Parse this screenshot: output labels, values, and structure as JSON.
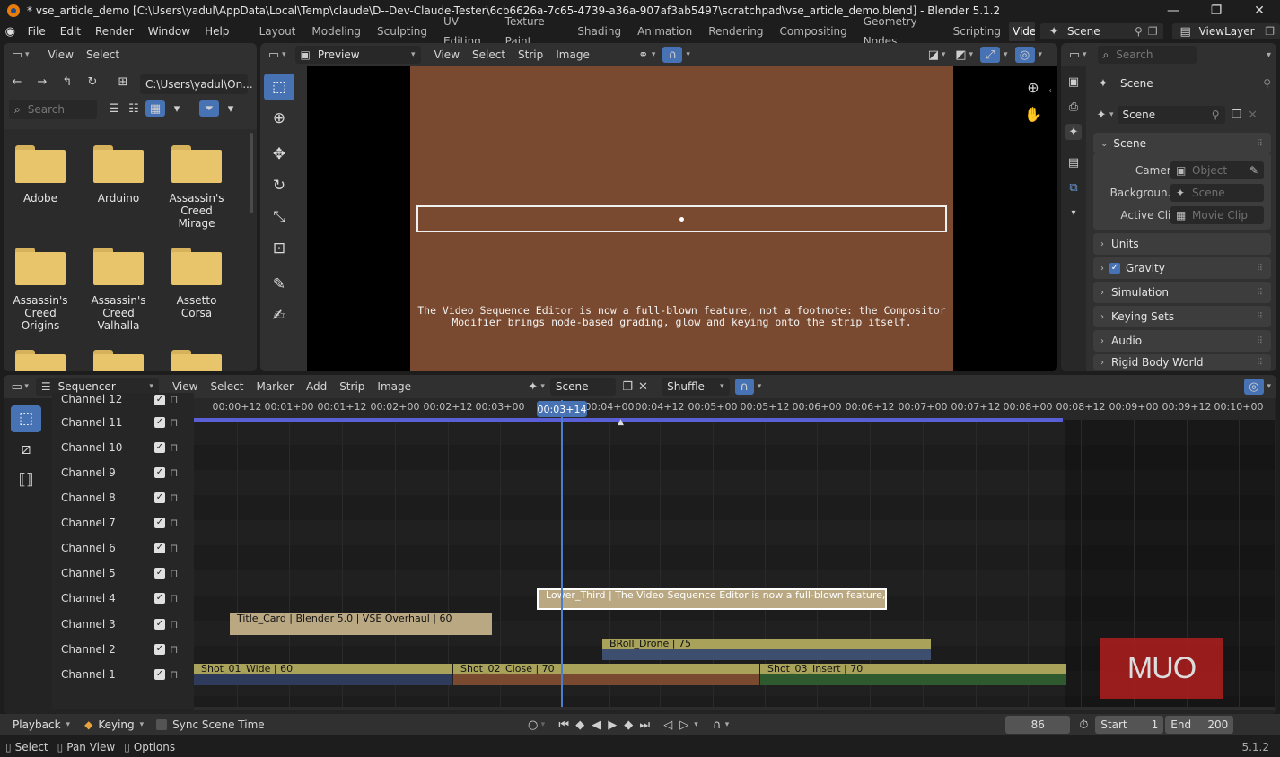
{
  "window": {
    "title": "* vse_article_demo [C:\\Users\\yadul\\AppData\\Local\\Temp\\claude\\D--Dev-Claude-Tester\\6cb6626a-7c65-4739-a36a-907af3ab5497\\scratchpad\\vse_article_demo.blend] - Blender 5.1.2",
    "minimize": "—",
    "maximize": "❐",
    "close": "✕"
  },
  "menu": {
    "items": [
      "File",
      "Edit",
      "Render",
      "Window",
      "Help"
    ],
    "workspaces": [
      "Layout",
      "Modeling",
      "Sculpting",
      "UV Editing",
      "Texture Paint",
      "Shading",
      "Animation",
      "Rendering",
      "Compositing",
      "Geometry Nodes",
      "Scripting",
      "Video"
    ],
    "active_workspace": "Video",
    "scene_name": "Scene",
    "view_layer": "ViewLayer"
  },
  "file_browser": {
    "menus": [
      "View",
      "Select"
    ],
    "path": "C:\\Users\\yadul\\On...",
    "search_placeholder": "Search",
    "folders": [
      "Adobe",
      "Arduino",
      "Assassin's Creed Mirage",
      "Assassin's Creed Origins",
      "Assassin's Creed Valhalla",
      "Assetto Corsa"
    ]
  },
  "preview": {
    "mode": "Preview",
    "menus": [
      "View",
      "Select",
      "Strip",
      "Image"
    ],
    "caption_line1": "The Video Sequence Editor is now a full-blown feature, not a footnote: the Compositor",
    "caption_line2": "Modifier brings node-based grading, glow and keying onto the strip itself.",
    "canvas_color": "#7a4a30"
  },
  "properties": {
    "search_placeholder": "Search",
    "context": "Scene",
    "datablock": "Scene",
    "section_scene": "Scene",
    "rows": [
      {
        "label": "Camera",
        "value": "Object"
      },
      {
        "label": "Backgroun...",
        "value": "Scene"
      },
      {
        "label": "Active Clip",
        "value": "Movie Clip"
      }
    ],
    "panels": [
      "Units",
      "Gravity",
      "Simulation",
      "Keying Sets",
      "Audio",
      "Rigid Body World"
    ],
    "gravity_checked": true
  },
  "sequencer": {
    "editor_type": "Sequencer",
    "menus": [
      "View",
      "Select",
      "Marker",
      "Add",
      "Strip",
      "Image"
    ],
    "scene": "Scene",
    "overlap_mode": "Shuffle",
    "current_time": "00:03+14",
    "timecodes": [
      "00:00+12",
      "00:01+00",
      "00:01+12",
      "00:02+00",
      "00:02+12",
      "00:03+00",
      "00:04+00",
      "00:04+12",
      "00:05+00",
      "00:05+12",
      "00:06+00",
      "00:06+12",
      "00:07+00",
      "00:07+12",
      "00:08+00",
      "00:08+12",
      "00:09+00",
      "00:09+12",
      "00:10+00"
    ],
    "channels": [
      "Channel 12",
      "Channel 11",
      "Channel 10",
      "Channel 9",
      "Channel 8",
      "Channel 7",
      "Channel 6",
      "Channel 5",
      "Channel 4",
      "Channel 3",
      "Channel 2",
      "Channel 1"
    ],
    "strips": [
      {
        "label": "Lower_Third | The Video Sequence Editor is now a full-blown feature, not",
        "channel": 4,
        "color": "#b9a882",
        "selected": true
      },
      {
        "label": "Title_Card | Blender 5.0  |  VSE Overhaul | 60",
        "channel": 3,
        "color": "#b9a882"
      },
      {
        "label": "BRoll_Drone | 75",
        "channel": 2,
        "color": "#a8a25a"
      },
      {
        "label": "Shot_01_Wide | 60",
        "channel": 1,
        "color": "#a8a25a"
      },
      {
        "label": "Shot_02_Close | 70",
        "channel": 1,
        "color": "#a8a25a"
      },
      {
        "label": "Shot_03_Insert | 70",
        "channel": 1,
        "color": "#a8a25a"
      }
    ],
    "watermark": "MUO"
  },
  "playback": {
    "playback_label": "Playback",
    "keying_label": "Keying",
    "sync_label": "Sync Scene Time",
    "frame": "86",
    "start_label": "Start",
    "start": "1",
    "end_label": "End",
    "end": "200"
  },
  "status": {
    "select": "Select",
    "pan": "Pan View",
    "options": "Options",
    "version": "5.1.2"
  },
  "colors": {
    "accent": "#4772b3",
    "playhead": "#4a7fd0",
    "timeline_range": "#5b5fd6"
  }
}
